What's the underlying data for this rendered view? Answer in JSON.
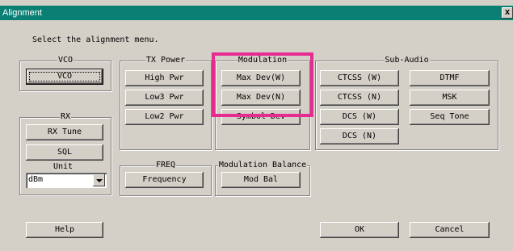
{
  "window": {
    "title": "Alignment",
    "close_label": "x"
  },
  "instruction": "Select the alignment menu.",
  "vco": {
    "legend": "VCO",
    "button": "VCO"
  },
  "rx": {
    "legend": "RX",
    "tune": "RX Tune",
    "sql": "SQL",
    "unit_label": "Unit",
    "unit_value": "dBm"
  },
  "tx_power": {
    "legend": "TX Power",
    "high": "High Pwr",
    "low3": "Low3 Pwr",
    "low2": "Low2 Pwr"
  },
  "modulation": {
    "legend": "Modulation",
    "max_dev_w": "Max Dev(W)",
    "max_dev_n": "Max Dev(N)",
    "symbol_dev": "Symbol Dev"
  },
  "sub_audio": {
    "legend": "Sub-Audio",
    "ctcss_w": "CTCSS (W)",
    "ctcss_n": "CTCSS (N)",
    "dcs_w": "DCS (W)",
    "dcs_n": "DCS (N)",
    "dtmf": "DTMF",
    "msk": "MSK",
    "seq_tone": "Seq Tone"
  },
  "freq": {
    "legend": "FREQ",
    "button": "Frequency"
  },
  "mod_balance": {
    "legend": "Modulation Balance",
    "button": "Mod Bal"
  },
  "footer": {
    "help": "Help",
    "ok": "OK",
    "cancel": "Cancel"
  },
  "highlight_color": "#e62b91"
}
